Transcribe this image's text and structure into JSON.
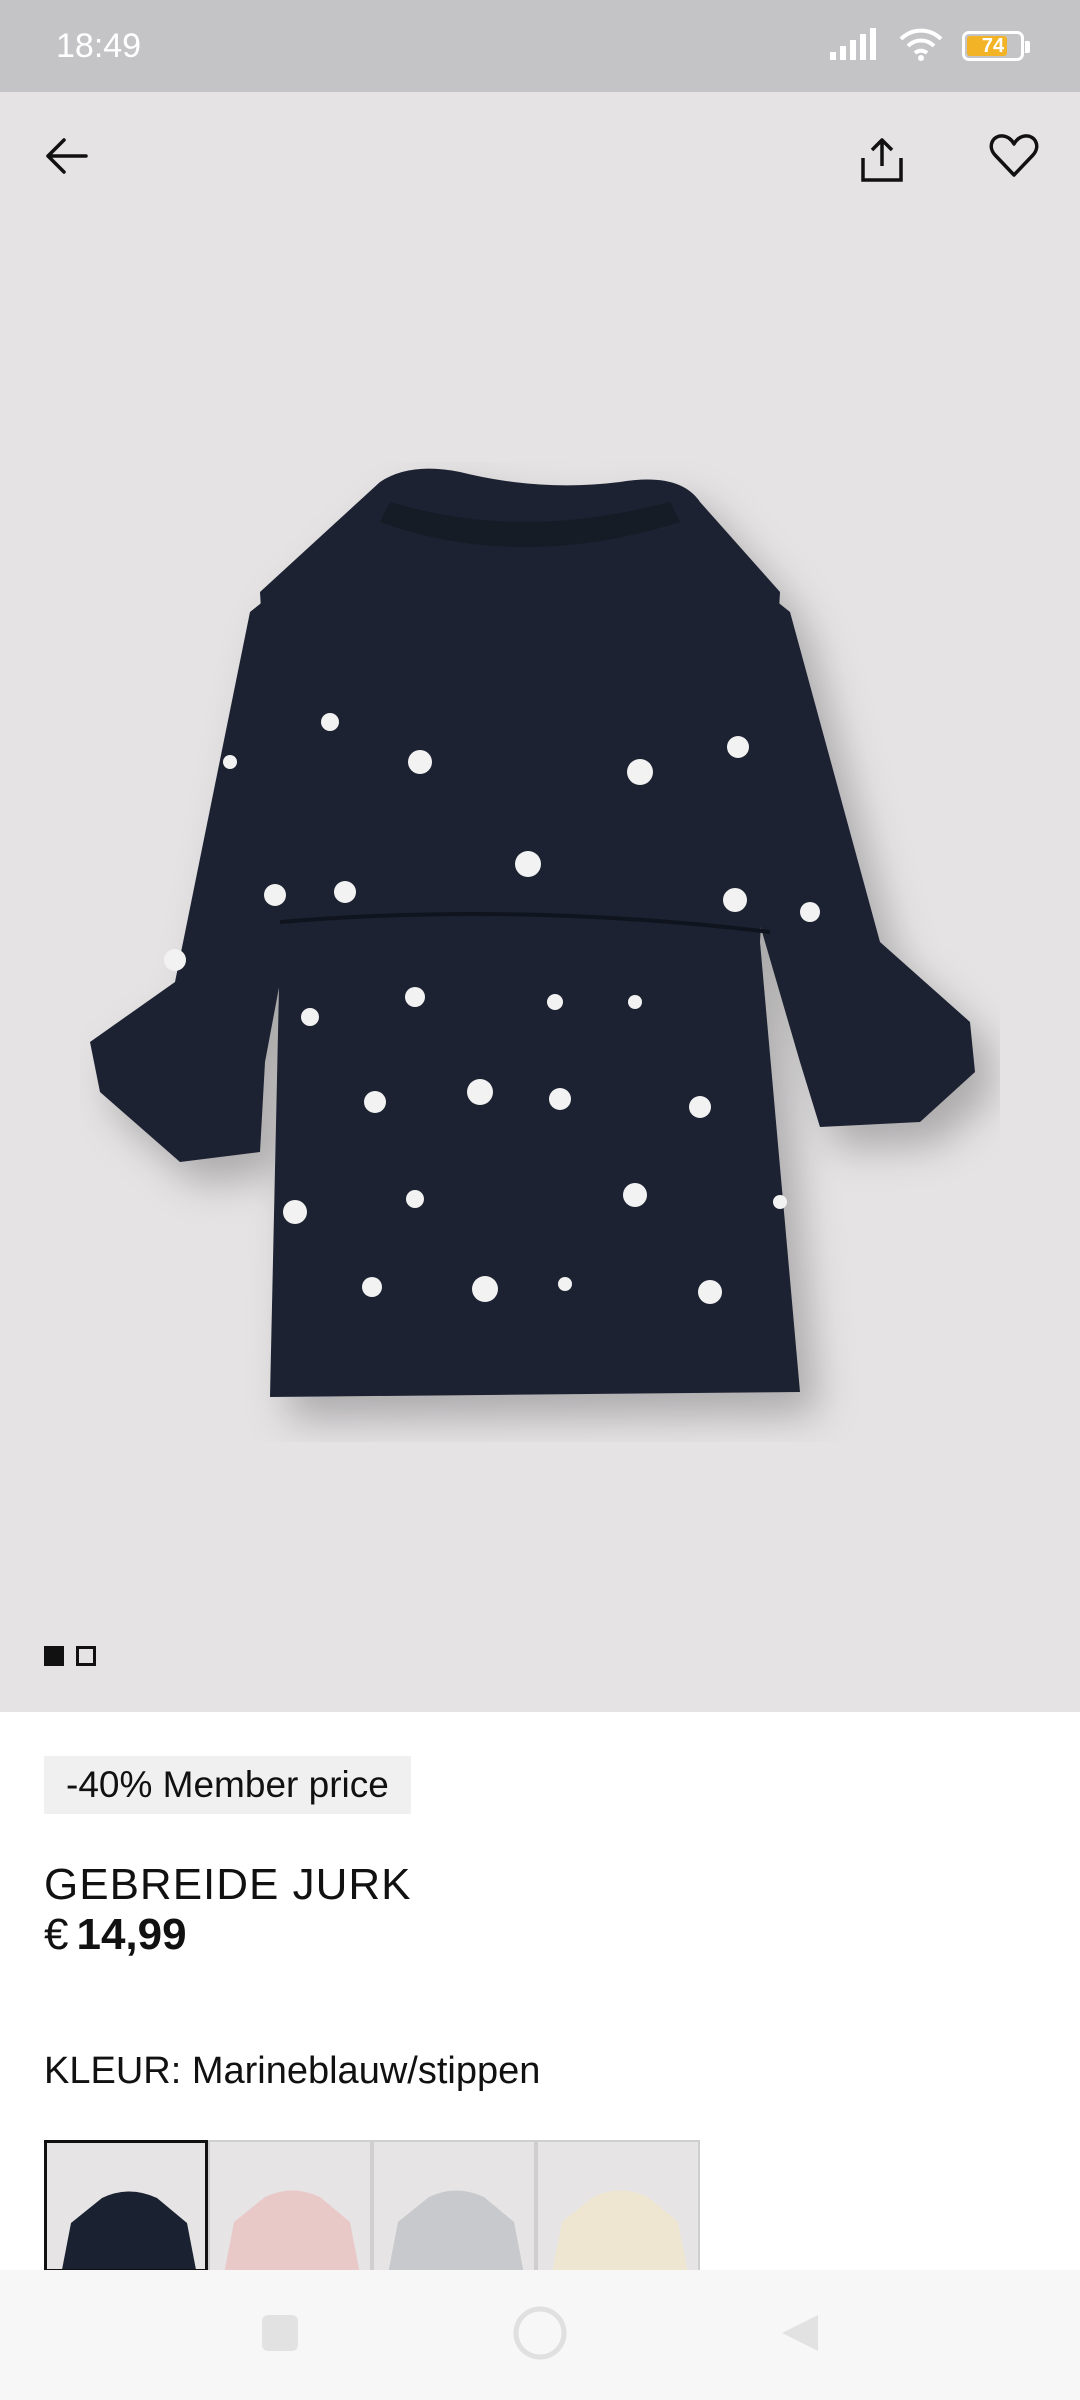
{
  "status_bar": {
    "time": "18:49",
    "battery_level": "74",
    "battery_fraction": 0.74,
    "icons": [
      "signal-icon",
      "wifi-icon",
      "battery-icon"
    ]
  },
  "hero": {
    "icons": [
      "back-arrow-icon",
      "share-icon",
      "heart-icon"
    ],
    "image_count": 2,
    "current_image": 1
  },
  "product": {
    "badge": "-40% Member price",
    "name": "GEBREIDE JURK",
    "currency": "€",
    "price": "14,99",
    "color_label": "KLEUR: Marineblauw/stippen"
  },
  "swatches": [
    {
      "name": "navy-dots",
      "color": "#1a2130",
      "selected": true
    },
    {
      "name": "pink",
      "color": "#e9c9c8",
      "selected": false
    },
    {
      "name": "grey",
      "color": "#c7c9cc",
      "selected": false
    },
    {
      "name": "cream",
      "color": "#efe6d2",
      "selected": false
    }
  ],
  "colors": {
    "status_bar_bg": "#c4c4c6",
    "hero_bg": "#e5e3e4",
    "dress": "#1b2130",
    "battery": "#f2b426"
  },
  "nav_bar": {
    "icons": [
      "recent-apps-icon",
      "home-icon",
      "back-icon"
    ]
  }
}
